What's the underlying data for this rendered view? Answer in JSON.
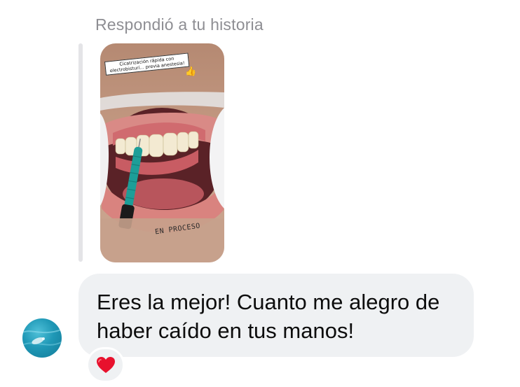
{
  "reply_header": {
    "label": "Respondió a tu historia"
  },
  "story": {
    "caption_line1": "Cicatrización rápida con",
    "caption_line2": "electrobisturí... previa anestesia!",
    "caption_icon": "thumbs-up-icon",
    "status_text": "EN PROCESO"
  },
  "message": {
    "line1": "Eres la mejor! Cuanto me alegro de",
    "line2": "haber caído en tus manos!",
    "reaction_icon": "red-heart-icon",
    "reaction_color": "#e8112d"
  },
  "sender": {
    "avatar_icon": "ocean-avatar"
  },
  "colors": {
    "bubble_bg": "#eff1f3",
    "label_gray": "#8e8e93",
    "quote_bar": "#e4e4e7"
  }
}
